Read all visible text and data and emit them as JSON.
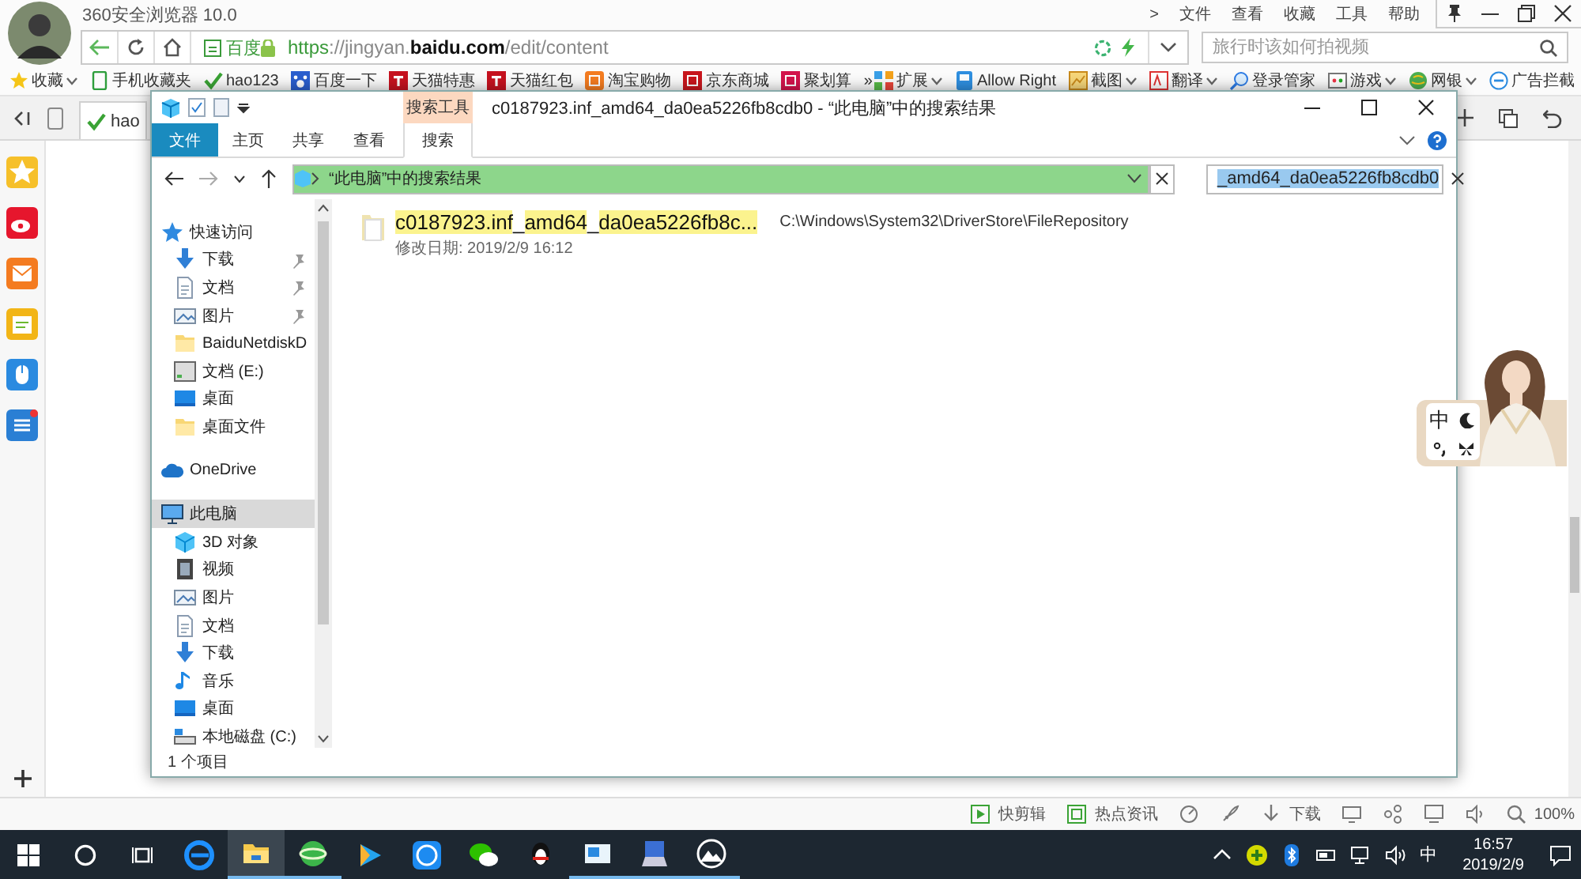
{
  "browser": {
    "title": "360安全浏览器 10.0",
    "menu": [
      ">",
      "文件",
      "查看",
      "收藏",
      "工具",
      "帮助"
    ],
    "address": {
      "site_badge": "百度",
      "url": "https://jingyan.**baidu.com**/edit/content"
    },
    "search": {
      "placeholder": "旅行时该如何拍视频"
    },
    "bookmarks": [
      {
        "label": "收藏",
        "dropdown": true
      },
      {
        "label": "手机收藏夹",
        "dropdown": false
      },
      {
        "label": "hao123",
        "dropdown": false
      },
      {
        "label": "百度一下",
        "dropdown": false
      },
      {
        "label": "天猫特惠",
        "dropdown": false
      },
      {
        "label": "天猫红包",
        "dropdown": false
      },
      {
        "label": "淘宝购物",
        "dropdown": false
      },
      {
        "label": "京东商城",
        "dropdown": false
      },
      {
        "label": "聚划算",
        "dropdown": false
      },
      {
        "label": "»",
        "dropdown": false
      }
    ],
    "tools": [
      {
        "label": "扩展",
        "dropdown": true
      },
      {
        "label": "Allow Right",
        "dropdown": false
      },
      {
        "label": "截图",
        "dropdown": true
      },
      {
        "label": "翻译",
        "dropdown": true
      },
      {
        "label": "登录管家",
        "dropdown": false
      },
      {
        "label": "游戏",
        "dropdown": true
      },
      {
        "label": "网银",
        "dropdown": true
      },
      {
        "label": "广告拦截",
        "dropdown": false
      }
    ],
    "tab": {
      "label": "hao"
    },
    "status": [
      {
        "label": "快剪辑"
      },
      {
        "label": "热点资讯"
      },
      {
        "label": "下载"
      },
      {
        "label": "100%"
      }
    ]
  },
  "explorer": {
    "title": "c0187923.inf_amd64_da0ea5226fb8cdb0 - “此电脑”中的搜索结果",
    "context_group": "搜索工具",
    "ribbon_tabs": [
      {
        "label": "文件",
        "kind": "file",
        "selected": false
      },
      {
        "label": "主页",
        "kind": "tab",
        "selected": false
      },
      {
        "label": "共享",
        "kind": "tab",
        "selected": false
      },
      {
        "label": "查看",
        "kind": "tab",
        "selected": false
      },
      {
        "label": "搜索",
        "kind": "tab",
        "selected": true
      }
    ],
    "address": {
      "text": "“此电脑”中的搜索结果",
      "level": 1
    },
    "search": {
      "value": "_amd64_da0ea5226fb8cdb0",
      "selected": true
    },
    "nav": [
      {
        "label": "快速访问",
        "selected": false,
        "children": [
          {
            "label": "下载",
            "pinned": true,
            "selected": false
          },
          {
            "label": "文档",
            "pinned": true,
            "selected": false
          },
          {
            "label": "图片",
            "pinned": true,
            "selected": false
          },
          {
            "label": "BaiduNetdiskD",
            "pinned": false,
            "selected": false
          },
          {
            "label": "文档 (E:)",
            "pinned": false,
            "selected": false
          },
          {
            "label": "桌面",
            "pinned": false,
            "selected": false
          },
          {
            "label": "桌面文件",
            "pinned": false,
            "selected": false
          }
        ]
      },
      {
        "label": "OneDrive",
        "selected": false
      },
      {
        "label": "此电脑",
        "selected": true,
        "children": [
          {
            "label": "3D 对象",
            "selected": false
          },
          {
            "label": "视频",
            "selected": false
          },
          {
            "label": "图片",
            "selected": false
          },
          {
            "label": "文档",
            "selected": false
          },
          {
            "label": "下载",
            "selected": false
          },
          {
            "label": "音乐",
            "selected": false
          },
          {
            "label": "桌面",
            "selected": false
          },
          {
            "label": "本地磁盘 (C:)",
            "selected": false
          }
        ]
      }
    ],
    "result": {
      "name_parts": [
        {
          "text": "c0187923.inf",
          "highlighted": true
        },
        {
          "text": "_",
          "highlighted": false
        },
        {
          "text": "amd64",
          "highlighted": true
        },
        {
          "text": "_",
          "highlighted": false
        },
        {
          "text": "da0ea5226fb8c...",
          "highlighted": true
        }
      ],
      "path": "C:\\Windows\\System32\\DriverStore\\FileRepository",
      "date": "修改日期: 2019/2/9 16:12"
    },
    "status": "1 个项目"
  },
  "ime": {
    "label": "中"
  },
  "taskbar": {
    "apps": [
      {
        "running": false,
        "active": false
      },
      {
        "running": true,
        "active": true
      },
      {
        "running": true,
        "active": false
      },
      {
        "running": false,
        "active": false
      },
      {
        "running": false,
        "active": false
      },
      {
        "running": false,
        "active": false
      },
      {
        "running": false,
        "active": false
      },
      {
        "running": true,
        "active": false
      },
      {
        "running": true,
        "active": false
      },
      {
        "running": true,
        "active": false
      }
    ],
    "ime": "中",
    "time": "16:57",
    "date": "2019/2/9"
  }
}
